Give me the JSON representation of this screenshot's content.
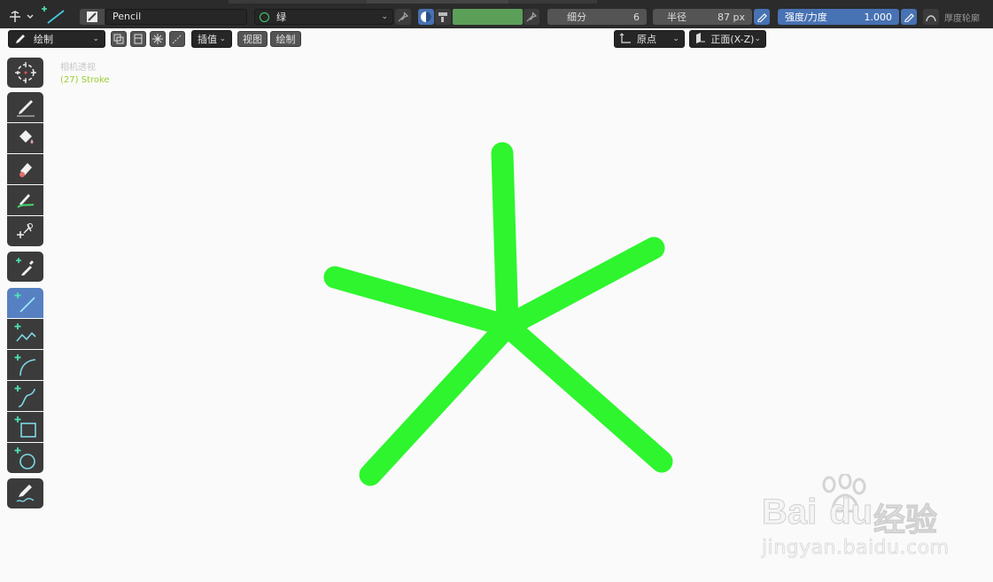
{
  "header": {
    "brush_name": "Pencil",
    "material_name": "绿",
    "subdivide_label": "细分",
    "subdivide_value": "6",
    "radius_label": "半径",
    "radius_value": "87 px",
    "strength_label": "强度/力度",
    "strength_value": "1.000",
    "thickness_profile_label": "厚度轮廓",
    "material_color": "#5b9f58"
  },
  "subheader": {
    "mode_label": "绘制",
    "interpolate_label": "插值",
    "view_label": "视图",
    "draw_label": "绘制",
    "origin_label": "原点",
    "plane_label": "正面(X-Z)"
  },
  "viewport": {
    "camera_label": "相机透视",
    "object_label": "(27) Stroke",
    "stroke_color": "#2ef52e",
    "object_label_color": "#9acd32"
  },
  "toolbar": {
    "icons": [
      "cursor-icon",
      "draw-icon",
      "fill-icon",
      "erase-icon",
      "tint-icon",
      "cutter-icon",
      "eyedropper-icon",
      "line-icon",
      "polyline-icon",
      "arc-icon",
      "curve-icon",
      "box-icon",
      "circle-icon",
      "annotate-icon"
    ]
  },
  "watermark": {
    "brand": "Bai",
    "brand_suffix": "du",
    "product": "经验",
    "url": "jingyan.baidu.com"
  }
}
